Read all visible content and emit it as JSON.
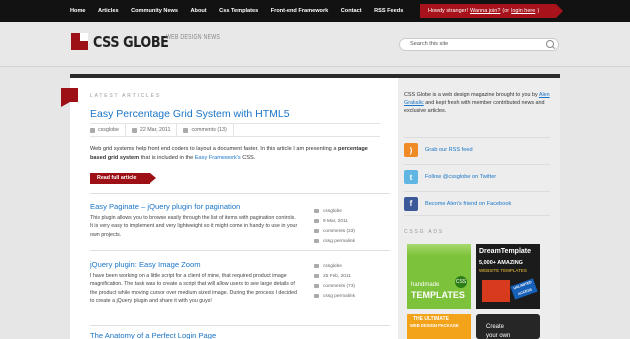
{
  "topnav": {
    "items": [
      "Home",
      "Articles",
      "Community News",
      "About",
      "Css Templates",
      "Front-end Framework",
      "Contact",
      "RSS Feeds"
    ],
    "howdy": {
      "prefix": "Howdy stranger!",
      "join": "Wanna join?",
      "middle": "(or",
      "login": "login here",
      "suffix": ")"
    }
  },
  "header": {
    "logo": "CSS GLOBE",
    "tagline": "WEB DESIGN NEWS",
    "search_placeholder": "Search this site"
  },
  "main": {
    "section_label": "LATEST ARTICLES",
    "featured": {
      "title": "Easy Percentage Grid System with HTML5",
      "author": "cssglobe",
      "date": "22 Mar, 2011",
      "comments": "comments (13)",
      "excerpt_1": "Web grid systems help front end coders to layout a document faster. In this article I am presenting a",
      "excerpt_bold": "percentage based grid system",
      "excerpt_2": "that is included in the",
      "excerpt_link": "Easy Framework's",
      "excerpt_3": "CSS.",
      "read_more": "Read full article"
    },
    "posts": [
      {
        "title": "Easy Paginate – jQuery plugin for pagination",
        "excerpt": "This plugin allows you to browse easily through the list of items with pagination controls. It is very easy to implement and very lightweight so it might come in handy to use in your own projects.",
        "author": "cssglobe",
        "date": "9 Mar, 2011",
        "comments": "comments (33)",
        "permalink": "cssg permalink"
      },
      {
        "title": "jQuery plugin: Easy Image Zoom",
        "excerpt": "I have been working on a little script for a client of mine, that required product image magnification. The task was to create a script that will allow users to see large details of the product while moving cursor over medium sized image. During the process I decided to create a jQuery plugin and share it with you guys!",
        "author": "cssglobe",
        "date": "25 Feb, 2011",
        "comments": "comments (73)",
        "permalink": "cssg permalink"
      },
      {
        "title": "The Anatomy of a Perfect Login Page"
      }
    ]
  },
  "sidebar": {
    "about_1": "CSS Globe is a web design magazine brought to you by",
    "about_link": "Alen Grakalic",
    "about_2": "and kept fresh with member contributed news and exclusive articles.",
    "links": [
      {
        "icon": "rss-icon",
        "label": "Grab our RSS feed",
        "color": "#f08a24"
      },
      {
        "icon": "twitter-icon",
        "label": "Follow @cssglobe on Twitter",
        "color": "#5fb6e2"
      },
      {
        "icon": "facebook-icon",
        "label": "Become Alen's friend on Facebook",
        "color": "#3b5998"
      }
    ],
    "ads_label": "CSSG ADS",
    "ads": {
      "handmade": "handmade",
      "templates": "TEMPLATES",
      "css": "CSS",
      "dream_brand": "DreamTemplate",
      "dream_amount": "5,000+ AMAZING",
      "dream_text": "WEBSITE TEMPLATES",
      "dream_badge": "UNLIMITED ACCESS",
      "ultimate_1": "THE ULTIMATE",
      "ultimate_2": "WEB DESIGN PACKAGE",
      "create_1": "Create",
      "create_2": "your own"
    }
  },
  "colors": {
    "accent": "#9c1016",
    "link": "#1a75c8",
    "topbar": "#121212"
  }
}
